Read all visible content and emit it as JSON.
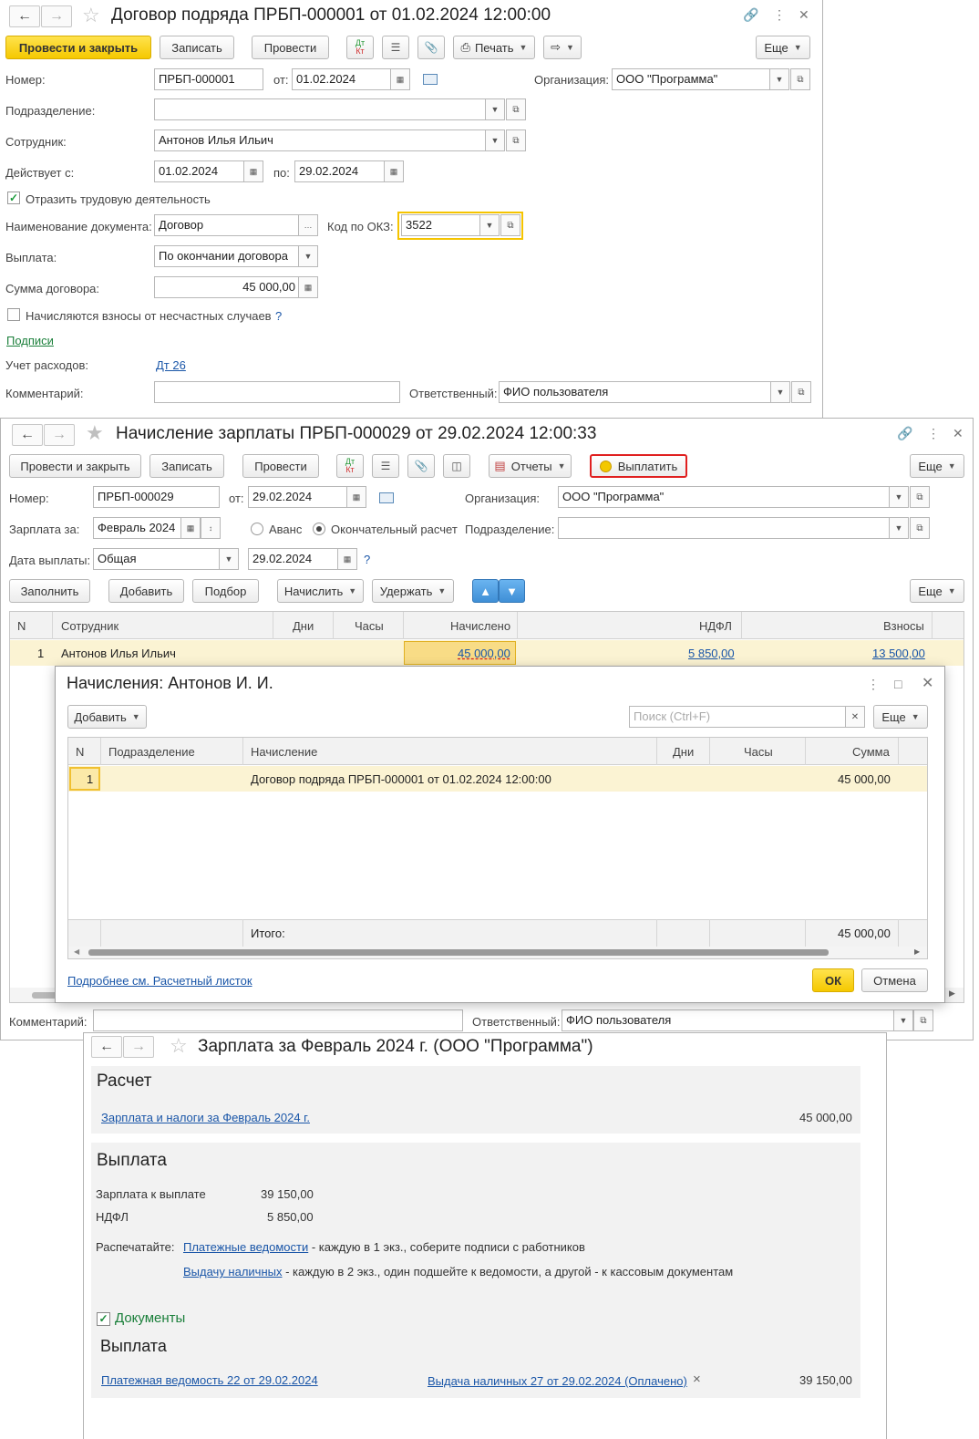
{
  "w1": {
    "title": "Договор подряда ПРБП-000001 от 01.02.2024 12:00:00",
    "btn_post_close": "Провести и закрыть",
    "btn_save": "Записать",
    "btn_post": "Провести",
    "btn_print": "Печать",
    "btn_more": "Еще",
    "dtkt_top": "Дт",
    "dtkt_bot": "Кт",
    "number_label": "Номер:",
    "number_value": "ПРБП-000001",
    "date_from_label": "от:",
    "date_value": "01.02.2024",
    "org_label": "Организация:",
    "org_value": "ООО \"Программа\"",
    "dept_label": "Подразделение:",
    "dept_value": "",
    "employee_label": "Сотрудник:",
    "employee_value": "Антонов Илья Ильич",
    "valid_label": "Действует с:",
    "valid_from": "01.02.2024",
    "valid_to_label": "по:",
    "valid_to": "29.02.2024",
    "reflect_label": "Отразить трудовую деятельность",
    "docname_label": "Наименование документа:",
    "docname_value": "Договор",
    "okz_label": "Код по ОКЗ:",
    "okz_value": "3522",
    "payout_label": "Выплата:",
    "payout_value": "По окончании договора",
    "sum_label": "Сумма договора:",
    "sum_value": "45 000,00",
    "accident_label": "Начисляются взносы от несчастных случаев",
    "help": "?",
    "signatures_link": "Подписи",
    "expense_label": "Учет расходов:",
    "expense_value": "Дт 26",
    "comment_label": "Комментарий:",
    "comment_value": "",
    "responsible_label": "Ответственный:",
    "responsible_value": "ФИО пользователя"
  },
  "w2": {
    "title": "Начисление зарплаты ПРБП-000029 от 29.02.2024 12:00:33",
    "btn_post_close": "Провести и закрыть",
    "btn_save": "Записать",
    "btn_post": "Провести",
    "btn_reports": "Отчеты",
    "btn_pay": "Выплатить",
    "btn_more": "Еще",
    "number_label": "Номер:",
    "number_value": "ПРБП-000029",
    "date_from_label": "от:",
    "date_value": "29.02.2024",
    "org_label": "Организация:",
    "org_value": "ООО \"Программа\"",
    "salary_for_label": "Зарплата за:",
    "salary_for_value": "Февраль 2024",
    "advance_label": "Аванс",
    "final_label": "Окончательный расчет",
    "dept_label": "Подразделение:",
    "dept_value": "",
    "paydate_label": "Дата выплаты:",
    "paydate_type": "Общая",
    "paydate_value": "29.02.2024",
    "help": "?",
    "tb_fill": "Заполнить",
    "tb_add": "Добавить",
    "tb_select": "Подбор",
    "tb_accrue": "Начислить",
    "tb_withhold": "Удержать",
    "tb_more": "Еще",
    "columns": [
      "N",
      "Сотрудник",
      "Дни",
      "Часы",
      "Начислено",
      "НДФЛ",
      "Взносы"
    ],
    "row": {
      "n": "1",
      "employee": "Антонов Илья Ильич",
      "accrued": "45 000,00",
      "ndfl": "5 850,00",
      "contrib": "13 500,00"
    },
    "comment_label": "Комментарий:",
    "comment_value": "",
    "responsible_label": "Ответственный:",
    "responsible_value": "ФИО пользователя"
  },
  "dialog": {
    "title": "Начисления: Антонов И. И.",
    "btn_add": "Добавить",
    "search_placeholder": "Поиск (Ctrl+F)",
    "btn_more": "Еще",
    "columns": [
      "N",
      "Подразделение",
      "Начисление",
      "Дни",
      "Часы",
      "Сумма"
    ],
    "row": {
      "n": "1",
      "dept": "",
      "accrual": "Договор подряда ПРБП-000001 от 01.02.2024 12:00:00",
      "sum": "45 000,00"
    },
    "total_label": "Итого:",
    "total_value": "45 000,00",
    "details_link": "Подробнее см. Расчетный листок",
    "btn_ok": "ОК",
    "btn_cancel": "Отмена"
  },
  "w3": {
    "title": "Зарплата за Февраль 2024 г. (ООО \"Программа\")",
    "calc_heading": "Расчет",
    "calc_link": "Зарплата и налоги за Февраль 2024 г.",
    "calc_value": "45 000,00",
    "pay_heading": "Выплата",
    "to_pay_label": "Зарплата к выплате",
    "to_pay_value": "39 150,00",
    "ndfl_label": "НДФЛ",
    "ndfl_value": "5 850,00",
    "print_label": "Распечатайте:",
    "print1_link": "Платежные ведомости",
    "print1_text": " - каждую в 1 экз., соберите подписи с работников",
    "print2_link": "Выдачу наличных",
    "print2_text": " - каждую в 2 экз., один подшейте к ведомости, а другой - к кассовым документам",
    "docs_label": "Документы",
    "docs_heading": "Выплата",
    "doc1_link": "Платежная ведомость 22 от 29.02.2024",
    "doc2_link": "Выдача наличных 27 от 29.02.2024 (Оплачено)",
    "doc_close": "×",
    "doc_value": "39 150,00"
  }
}
